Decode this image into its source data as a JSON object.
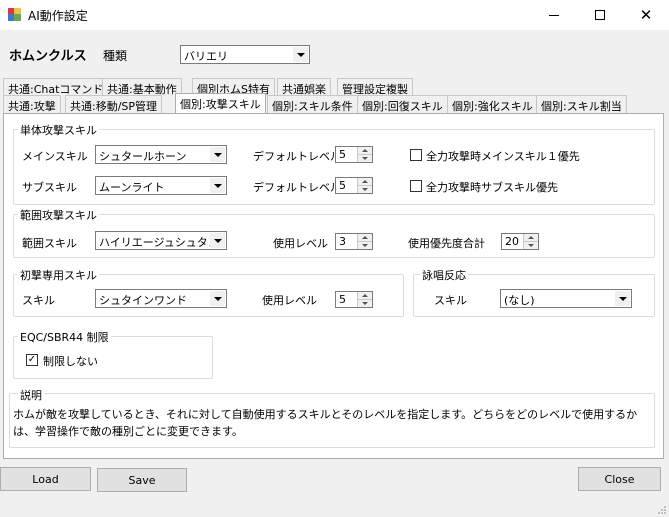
{
  "window": {
    "title": "AI動作設定",
    "icons": {
      "app": "app-grid-icon",
      "minimize": "minimize-icon",
      "maximize": "maximize-icon",
      "close": "close-icon"
    }
  },
  "header": {
    "name": "ホムンクルス",
    "type_label": "種類",
    "type_value": "バリエリ"
  },
  "tabs_row1": [
    "共通:Chatコマンド",
    "共通:基本動作",
    "個別ホムS特有",
    "共通娯楽",
    "管理設定複製"
  ],
  "tabs_row2": [
    "共通:攻撃",
    "共通:移動/SP管理",
    "個別:攻撃スキル",
    "個別:スキル条件",
    "個別:回復スキル",
    "個別:強化スキル",
    "個別:スキル割当"
  ],
  "active_tab": "個別:攻撃スキル",
  "single_attack": {
    "title": "単体攻撃スキル",
    "main_label": "メインスキル",
    "main_value": "シュタールホーン",
    "main_level_label": "デフォルトレベル",
    "main_level": "5",
    "main_check_label": "全力攻撃時メインスキル１優先",
    "main_checked": false,
    "sub_label": "サブスキル",
    "sub_value": "ムーンライト",
    "sub_level_label": "デフォルトレベル",
    "sub_level": "5",
    "sub_check_label": "全力攻撃時サブスキル優先",
    "sub_checked": false
  },
  "range_attack": {
    "title": "範囲攻撃スキル",
    "skill_label": "範囲スキル",
    "skill_value": "ハイリエージュシュタンゲ",
    "level_label": "使用レベル",
    "level": "3",
    "priority_label": "使用優先度合計",
    "priority": "20"
  },
  "first_attack": {
    "title": "初撃専用スキル",
    "skill_label": "スキル",
    "skill_value": "シュタインワンド",
    "level_label": "使用レベル",
    "level": "5"
  },
  "chant": {
    "title": "詠唱反応",
    "skill_label": "スキル",
    "skill_value": "(なし)"
  },
  "limit": {
    "title": "EQC/SBR44 制限",
    "check_label": "制限しない",
    "checked": true,
    "check_mark": "✓"
  },
  "description": {
    "title": "説明",
    "text": "ホムが敵を攻撃しているとき、それに対して自動使用するスキルとそのレベルを指定します。どちらをどのレベルで使用するかは、学習操作で敵の種別ごとに変更できます。"
  },
  "buttons": {
    "load": "Load",
    "save": "Save",
    "close": "Close"
  }
}
